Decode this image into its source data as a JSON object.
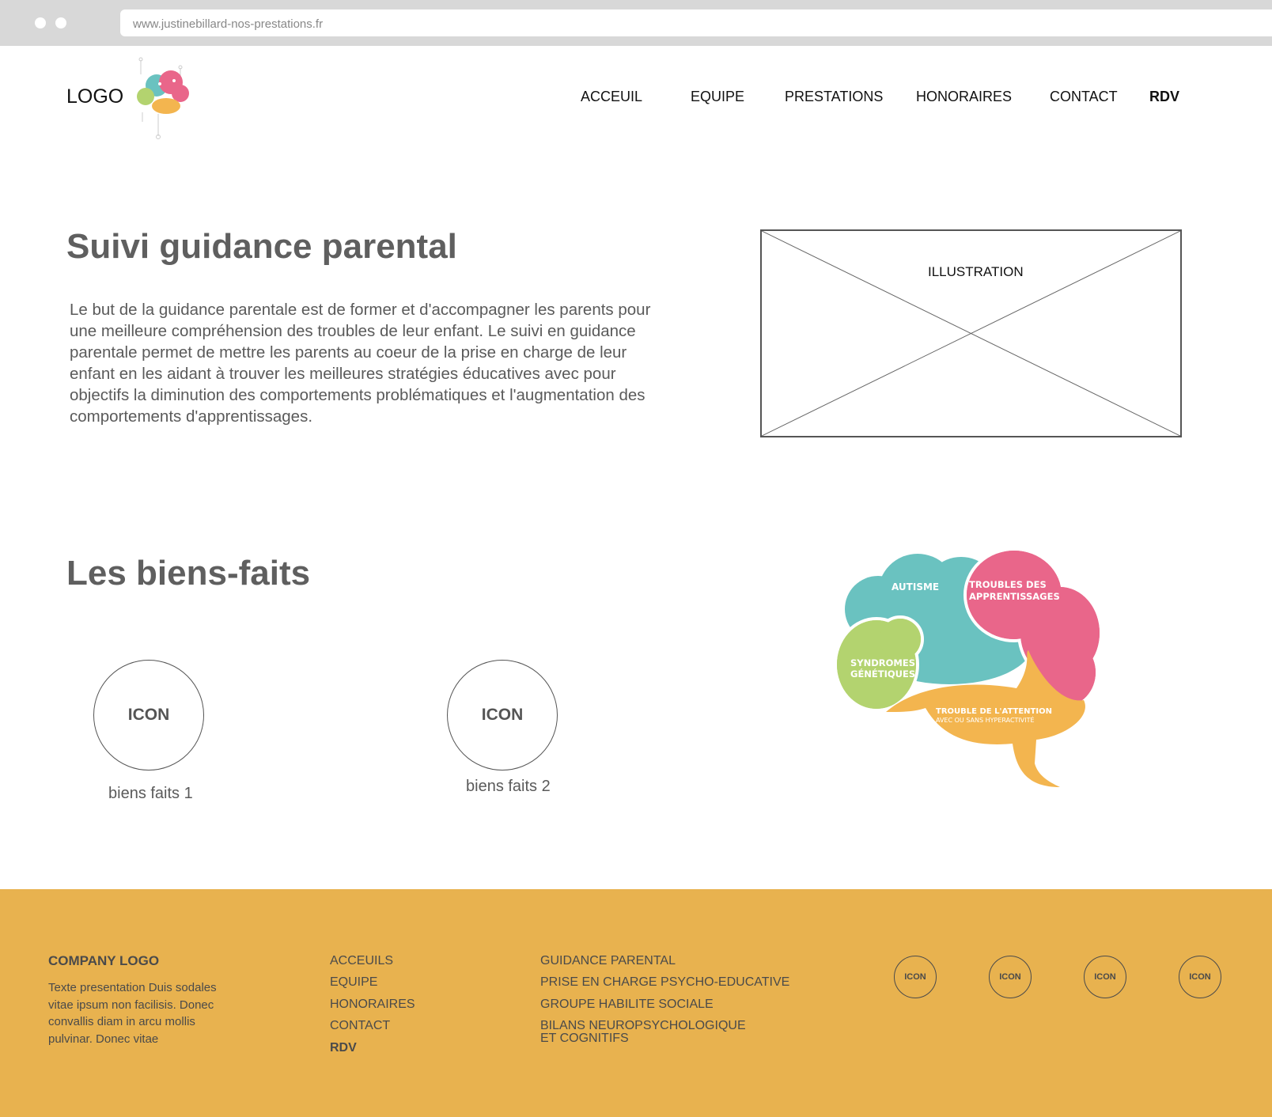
{
  "browser": {
    "url": "www.justinebillard-nos-prestations.fr"
  },
  "header": {
    "logo_label": "LOGO",
    "nav": [
      {
        "label": "ACCEUIL"
      },
      {
        "label": "EQUIPE"
      },
      {
        "label": "PRESTATIONS"
      },
      {
        "label": "HONORAIRES"
      },
      {
        "label": "CONTACT"
      },
      {
        "label": "RDV"
      }
    ]
  },
  "hero": {
    "title": "Suivi guidance parental",
    "description": "Le but de la guidance parentale est de former et d'accompagner les parents pour une meilleure compréhension des troubles de leur enfant. Le suivi en guidance parentale permet de mettre les parents au coeur de la prise en charge de leur enfant en les aidant à trouver les meilleures stratégies éducatives avec pour objectifs la diminution des comportements problématiques et l'augmentation des comportements d'apprentissages.",
    "illustration_label": "ILLUSTRATION"
  },
  "benefits": {
    "title": "Les biens-faits",
    "items": [
      {
        "icon_label": "ICON",
        "label": "biens faits 1"
      },
      {
        "icon_label": "ICON",
        "label": "biens faits 2"
      }
    ],
    "brain": {
      "autisme": "AUTISME",
      "troubles_line1": "TROUBLES DES",
      "troubles_line2": "APPRENTISSAGES",
      "syndromes_line1": "SYNDROMES",
      "syndromes_line2": "GÉNÉTIQUES",
      "attention_line1": "TROUBLE DE L'ATTENTION",
      "attention_line2": "AVEC OU SANS HYPERACTIVITÉ"
    }
  },
  "footer": {
    "company_logo": "COMPANY LOGO",
    "presentation": "Texte presentation Duis sodales vitae ipsum non facilisis. Donec convallis diam in arcu mollis pulvinar. Donec vitae",
    "links": [
      "ACCEUILS",
      "EQUIPE",
      "HONORAIRES",
      "CONTACT",
      "RDV"
    ],
    "services": [
      "GUIDANCE PARENTAL",
      "PRISE EN CHARGE PSYCHO-EDUCATIVE",
      "GROUPE HABILITE SOCIALE",
      "BILANS NEUROPSYCHOLOGIQUE ET COGNITIFS"
    ],
    "social_icons": [
      "ICON",
      "ICON",
      "ICON",
      "ICON"
    ]
  },
  "colors": {
    "footer_bg": "#e8b24f",
    "brain_teal": "#6ac2c0",
    "brain_pink": "#e9668a",
    "brain_green": "#b3d36f",
    "brain_orange": "#f3b54f",
    "heading_gray": "#5f5f5f"
  }
}
